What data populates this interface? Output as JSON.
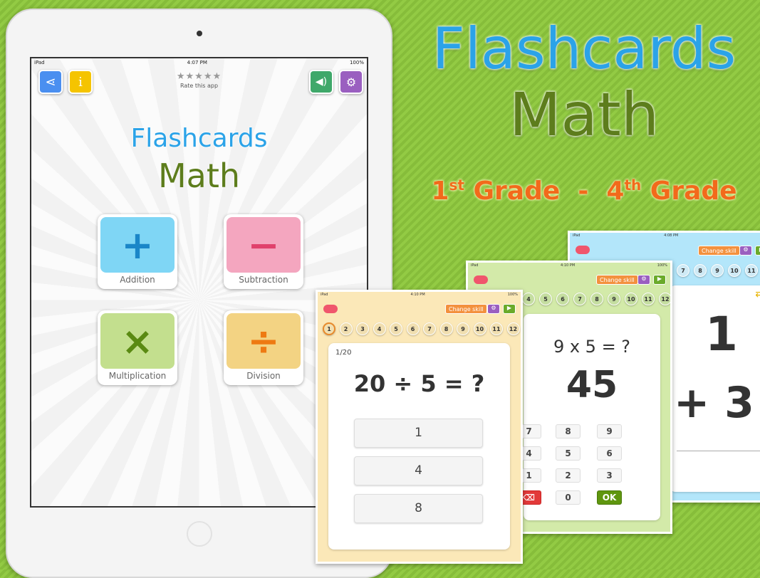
{
  "promo": {
    "title_line1": "Flashcards",
    "title_line2": "Math",
    "grade_from_num": "1",
    "grade_from_sup": "st",
    "grade_from_word": "Grade",
    "dash": "-",
    "grade_to_num": "4",
    "grade_to_sup": "th",
    "grade_to_word": "Grade"
  },
  "home": {
    "status": {
      "carrier": "iPad",
      "time": "4:07 PM",
      "battery": "100%"
    },
    "stars": "★★★★★",
    "rate_label": "Rate this app",
    "title_line1": "Flashcards",
    "title_line2": "Math",
    "skills": [
      {
        "label": "Addition",
        "symbol": "+",
        "color": "#7fd6f5",
        "symbol_color": "#1a86c8"
      },
      {
        "label": "Subtraction",
        "symbol": "−",
        "color": "#f4a6bf",
        "symbol_color": "#e0416c"
      },
      {
        "label": "Multiplication",
        "symbol": "×",
        "color": "#c3df8e",
        "symbol_color": "#5a8a12"
      },
      {
        "label": "Division",
        "symbol": "÷",
        "color": "#f3d383",
        "symbol_color": "#ee7a12"
      }
    ]
  },
  "screens": {
    "blue": {
      "status": {
        "carrier": "iPad",
        "time": "4:08 PM"
      },
      "change_skill": "Change skill",
      "nums": [
        "7",
        "8",
        "9",
        "10",
        "11"
      ],
      "top": "1",
      "bottom": "+ 3"
    },
    "green": {
      "status": {
        "carrier": "iPad",
        "time": "4:10 PM",
        "battery": "100%"
      },
      "change_skill": "Change skill",
      "nums": [
        "4",
        "5",
        "6",
        "7",
        "8",
        "9",
        "10",
        "11",
        "12"
      ],
      "question": "9 x 5 = ?",
      "answer": "45",
      "keys": [
        "7",
        "8",
        "9",
        "4",
        "5",
        "6",
        "1",
        "2",
        "3"
      ],
      "zero": "0",
      "ok": "OK"
    },
    "yellow": {
      "status": {
        "carrier": "iPad",
        "time": "4:10 PM",
        "battery": "100%"
      },
      "change_skill": "Change skill",
      "nums": [
        "1",
        "2",
        "3",
        "4",
        "5",
        "6",
        "7",
        "8",
        "9",
        "10",
        "11",
        "12"
      ],
      "progress": "1/20",
      "question": "20 ÷ 5 = ?",
      "answers": [
        "1",
        "4",
        "8"
      ]
    }
  },
  "colors": {
    "background": "#8ec63f",
    "accent_blue": "#2ba3e8",
    "accent_olive": "#5d7d1c",
    "accent_orange": "#f26a1b"
  }
}
